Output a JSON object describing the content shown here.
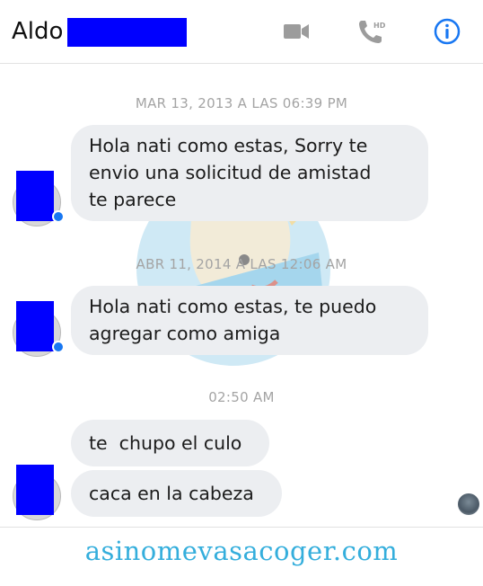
{
  "header": {
    "contact_name": "Aldo",
    "icons": [
      "video-icon",
      "phone-hd-icon",
      "info-icon"
    ],
    "phone_badge": "HD"
  },
  "thread": {
    "timestamps": [
      "MAR 13, 2013 A LAS 06:39 PM",
      "ABR 11, 2014 A LAS 12:06 AM",
      "02:50 AM"
    ],
    "messages": [
      "Hola nati como estas, Sorry te\nenvio una solicitud de amistad\nte parece",
      "Hola nati como estas, te puedo\nagregar como amiga",
      "te  chupo el culo",
      "caca en la cabeza"
    ]
  },
  "colors": {
    "redaction": "#0000ff",
    "bubble": "#eceef1",
    "accent": "#1877f2",
    "icon_gray": "#9c9c9c",
    "watermark": "#34aedc"
  },
  "watermark": {
    "site": "asinomevasacoger.com"
  }
}
